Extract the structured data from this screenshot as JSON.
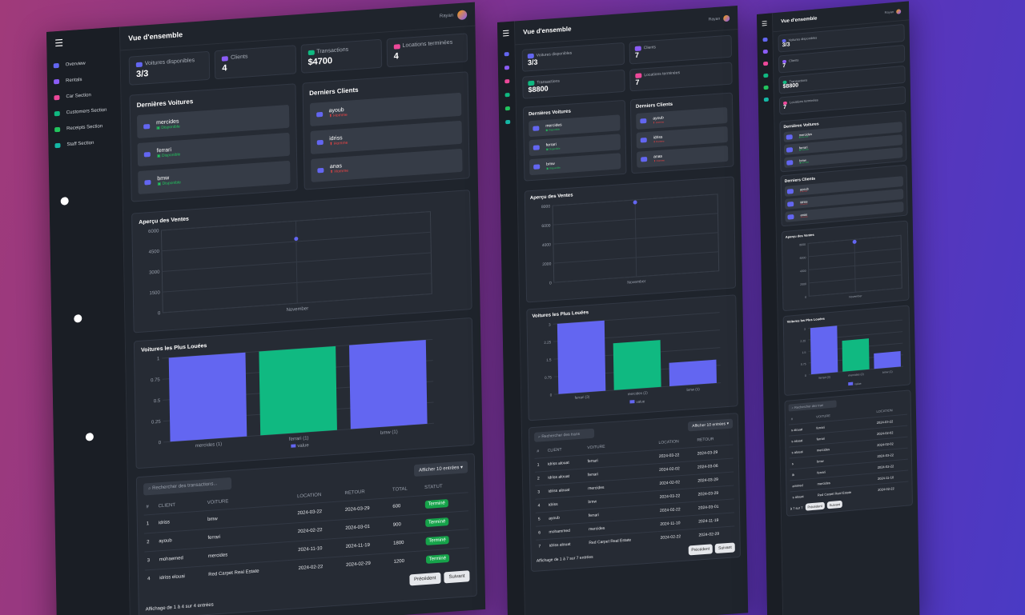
{
  "overview_title": "Vue d'ensemble",
  "user_name": "Rayan",
  "sidebar": {
    "items": [
      {
        "label": "Overview",
        "icon": "chart-icon",
        "color": "#6366f1"
      },
      {
        "label": "Rentals",
        "icon": "rentals-icon",
        "color": "#8b5cf6"
      },
      {
        "label": "Car Section",
        "icon": "car-icon",
        "color": "#ec4899"
      },
      {
        "label": "Customers Section",
        "icon": "users-icon",
        "color": "#10b981"
      },
      {
        "label": "Receipts Section",
        "icon": "receipt-icon",
        "color": "#22c55e"
      },
      {
        "label": "Staff Section",
        "icon": "staff-icon",
        "color": "#14b8a6"
      }
    ]
  },
  "stats": {
    "cars": {
      "label": "Voitures disponibles",
      "value": "3/3"
    },
    "clients": {
      "label": "Clients",
      "value": "4"
    },
    "transactions": {
      "label": "Transactions",
      "value": "$4700"
    },
    "rentals_done": {
      "label": "Locations terminées",
      "value": "4"
    }
  },
  "stats_tablet": {
    "clients": "7",
    "transactions": "$8800",
    "rentals_done": "7"
  },
  "latest_cars": {
    "title": "Dernières Voitures",
    "items": [
      {
        "name": "mercides",
        "status": "Disponible"
      },
      {
        "name": "ferrari",
        "status": "Disponible"
      },
      {
        "name": "bmw",
        "status": "Disponible"
      }
    ]
  },
  "latest_clients": {
    "title": "Derniers Clients",
    "items": [
      {
        "name": "ayoub",
        "tag": "Homme"
      },
      {
        "name": "idriss",
        "tag": "Homme"
      },
      {
        "name": "anas",
        "tag": "Homme"
      }
    ]
  },
  "sales_chart": {
    "title": "Aperçu des Ventes",
    "chart_data": {
      "type": "scatter",
      "x": [
        "November"
      ],
      "values": [
        4700
      ],
      "ylim": [
        0,
        6000
      ],
      "yticks": [
        0,
        1500,
        3000,
        4500,
        6000
      ],
      "title": "Aperçu des Ventes",
      "color": "#6366f1"
    }
  },
  "rented_chart": {
    "title": "Voitures les Plus Louées",
    "chart_data": {
      "type": "bar",
      "categories": [
        "mercides (1)",
        "ferrari (1)",
        "bmw (1)"
      ],
      "values": [
        1,
        1,
        1
      ],
      "ylim": [
        0,
        1
      ],
      "yticks": [
        0,
        0.25,
        0.5,
        0.75,
        1
      ],
      "legend": "value",
      "colors": [
        "#6366f1",
        "#10b981",
        "#6366f1"
      ]
    }
  },
  "rented_chart_tablet": {
    "categories": [
      "ferrari (3)",
      "mercides (2)",
      "bmw (1)"
    ],
    "values": [
      3,
      2,
      1
    ],
    "yticks": [
      0,
      0.75,
      1.5,
      2.25,
      3
    ]
  },
  "sales_chart_tablet": {
    "yticks": [
      0,
      2000,
      4000,
      6000,
      8000
    ],
    "value": 8800
  },
  "transactions_table": {
    "search_placeholder": "Rechercher des transactions...",
    "page_size_label": "Afficher 10 entrées",
    "columns": [
      "#",
      "CLIENT",
      "VOITURE",
      "LOCATION",
      "RETOUR",
      "TOTAL",
      "STATUT"
    ],
    "rows": [
      [
        "1",
        "idriss",
        "bmw",
        "2024-03-22",
        "2024-03-29",
        "600",
        "Terminé"
      ],
      [
        "2",
        "ayoub",
        "ferrari",
        "2024-02-22",
        "2024-03-01",
        "900",
        "Terminé"
      ],
      [
        "3",
        "mohaemed",
        "mercides",
        "2024-11-10",
        "2024-11-19",
        "1800",
        "Terminé"
      ],
      [
        "4",
        "idriss elouai",
        "Red Carpet Real Estate",
        "2024-02-22",
        "2024-02-29",
        "1200",
        "Terminé"
      ]
    ],
    "footer": "Affichage de 1 à 4 sur 4 entrées",
    "prev": "Précédent",
    "next": "Suivant"
  },
  "tablet_table": {
    "search_placeholder": "Rechercher des trans",
    "page_size_label": "Afficher 10 entrées",
    "columns": [
      "#",
      "CLIENT",
      "VOITURE",
      "LOCATION",
      "RETOUR"
    ],
    "rows": [
      [
        "1",
        "idriss alouat",
        "ferrari",
        "2024-03-22",
        "2024-03-29"
      ],
      [
        "2",
        "idriss alouat",
        "ferrari",
        "2024-02-02",
        "2024-03-06"
      ],
      [
        "3",
        "idriss alouat",
        "mercides",
        "2024-02-02",
        "2024-03-29"
      ],
      [
        "4",
        "idriss",
        "bmw",
        "2024-03-22",
        "2024-03-29"
      ],
      [
        "5",
        "ayoub",
        "ferrari",
        "2024-02-22",
        "2024-03-01"
      ],
      [
        "6",
        "mohammed",
        "mercides",
        "2024-11-10",
        "2024-11-19"
      ],
      [
        "7",
        "idriss alouat",
        "Red Carpet Real Estate",
        "2024-02-22",
        "2024-02-29"
      ]
    ],
    "footer": "Affichage de 1 à 7 sur 7 entrées"
  },
  "mobile_table": {
    "search_placeholder": "Rechercher des tran",
    "columns": [
      "#",
      "VOITURE",
      "LOCATION"
    ],
    "rows": [
      [
        "s alouat",
        "ferrari",
        "2024-03-22"
      ],
      [
        "s alouat",
        "ferrari",
        "2024-02-02"
      ],
      [
        "s alouat",
        "mercides",
        "2024-02-02"
      ],
      [
        "s",
        "bmw",
        "2024-03-22"
      ],
      [
        "ib",
        "ferrari",
        "2024-02-22"
      ],
      [
        "ammed",
        "mercides",
        "2024-11-10"
      ],
      [
        "s alouat",
        "Red Carpet Real Estate",
        "2024-02-22"
      ]
    ],
    "footer": "à 7 sur 7",
    "rented_categories": [
      "ferrari (3)",
      "mercides (2)",
      "bmw (1)"
    ]
  }
}
